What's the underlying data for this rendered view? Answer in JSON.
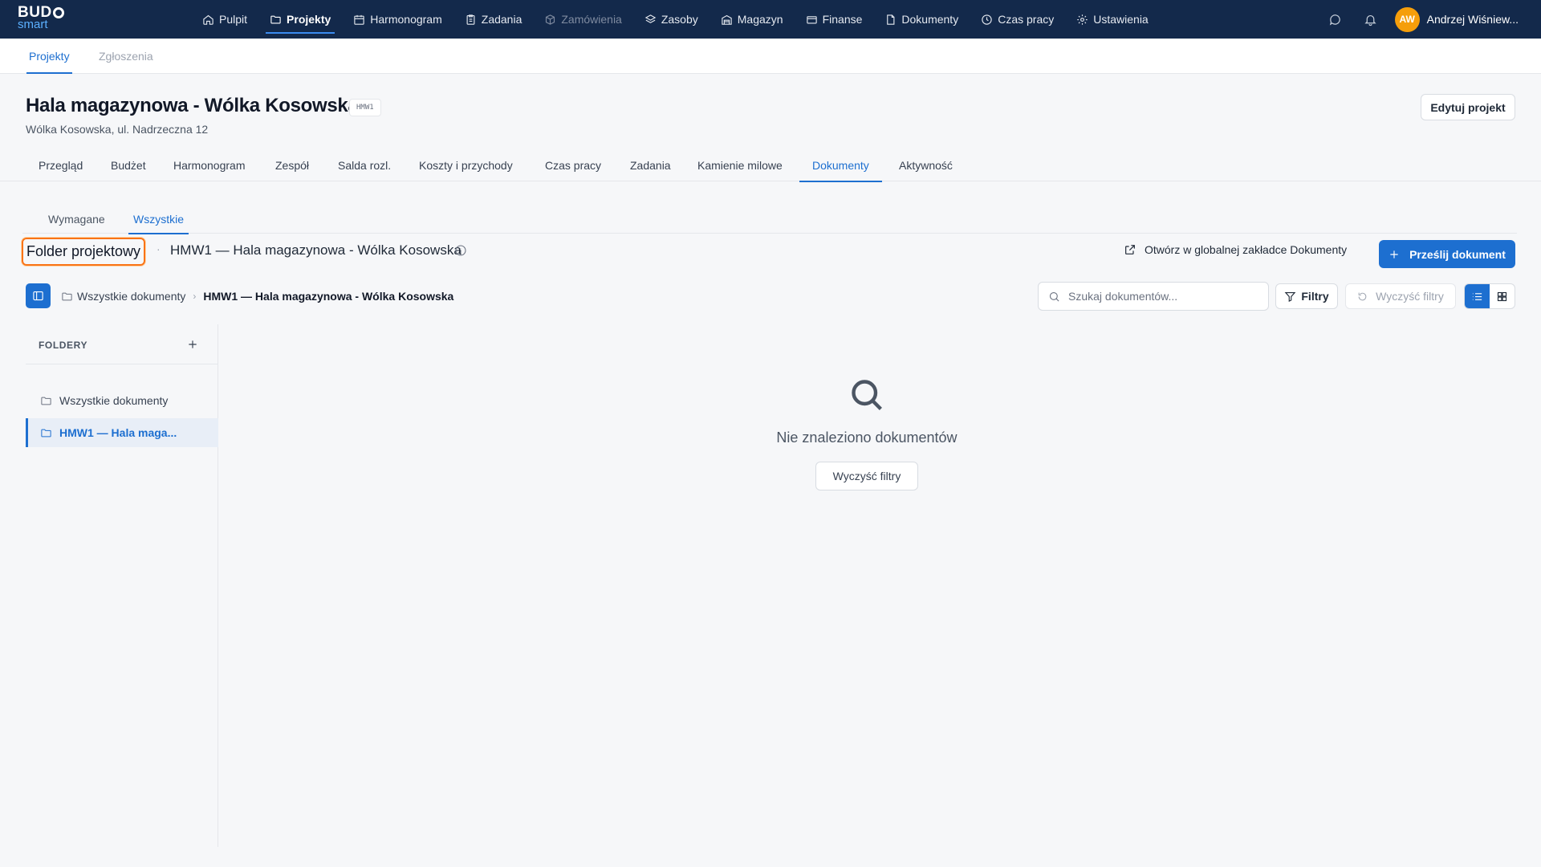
{
  "brand": {
    "line1": "BUD",
    "line2": "smart"
  },
  "nav": {
    "items": [
      {
        "label": "Pulpit",
        "icon": "home-icon"
      },
      {
        "label": "Projekty",
        "icon": "folder-icon",
        "active": true
      },
      {
        "label": "Harmonogram",
        "icon": "calendar-icon"
      },
      {
        "label": "Zadania",
        "icon": "clipboard-icon"
      },
      {
        "label": "Zamówienia",
        "icon": "box-icon",
        "disabled": true
      },
      {
        "label": "Zasoby",
        "icon": "layers-icon"
      },
      {
        "label": "Magazyn",
        "icon": "warehouse-icon"
      },
      {
        "label": "Finanse",
        "icon": "card-icon"
      },
      {
        "label": "Dokumenty",
        "icon": "document-icon"
      },
      {
        "label": "Czas pracy",
        "icon": "clock-icon"
      },
      {
        "label": "Ustawienia",
        "icon": "gear-icon"
      }
    ],
    "user": {
      "initials": "AW",
      "name": "Andrzej Wiśniew..."
    }
  },
  "subnav": {
    "tabs": [
      "Projekty",
      "Zgłoszenia"
    ]
  },
  "project": {
    "title": "Hala magazynowa - Wólka Kosowska",
    "code": "HMW1",
    "address": "Wólka Kosowska, ul. Nadrzeczna 12",
    "edit_label": "Edytuj projekt",
    "tabs": [
      "Przegląd",
      "Budżet",
      "Harmonogram",
      "Zespół",
      "Salda rozl.",
      "Koszty i przychody",
      "Czas pracy",
      "Zadania",
      "Kamienie milowe",
      "Dokumenty",
      "Aktywność"
    ],
    "active_tab": "Dokumenty"
  },
  "documents": {
    "tabs": [
      "Wymagane",
      "Wszystkie"
    ],
    "active_tab": "Wszystkie",
    "folder_type": "Folder projektowy",
    "separator": "·",
    "folder_name": "HMW1 — Hala magazynowa - Wólka Kosowska",
    "open_global_label": "Otwórz w globalnej zakładce Dokumenty",
    "upload_label": "Prześlij dokument",
    "breadcrumb": [
      "Wszystkie dokumenty",
      "HMW1 — Hala magazynowa - Wólka Kosowska"
    ],
    "search_placeholder": "Szukaj dokumentów...",
    "filters_label": "Filtry",
    "clear_filters_label": "Wyczyść filtry",
    "view_mode": "list",
    "folders": {
      "title": "FOLDERY",
      "items": [
        {
          "label": "Wszystkie dokumenty"
        },
        {
          "label": "HMW1 — Hala maga...",
          "active": true
        }
      ]
    },
    "empty": {
      "title": "Nie znaleziono dokumentów",
      "clear_label": "Wyczyść filtry"
    }
  },
  "colors": {
    "nav_bg": "#13294b",
    "accent": "#1d6fd0",
    "highlight": "#f97316",
    "avatar": "#f59e0b"
  }
}
